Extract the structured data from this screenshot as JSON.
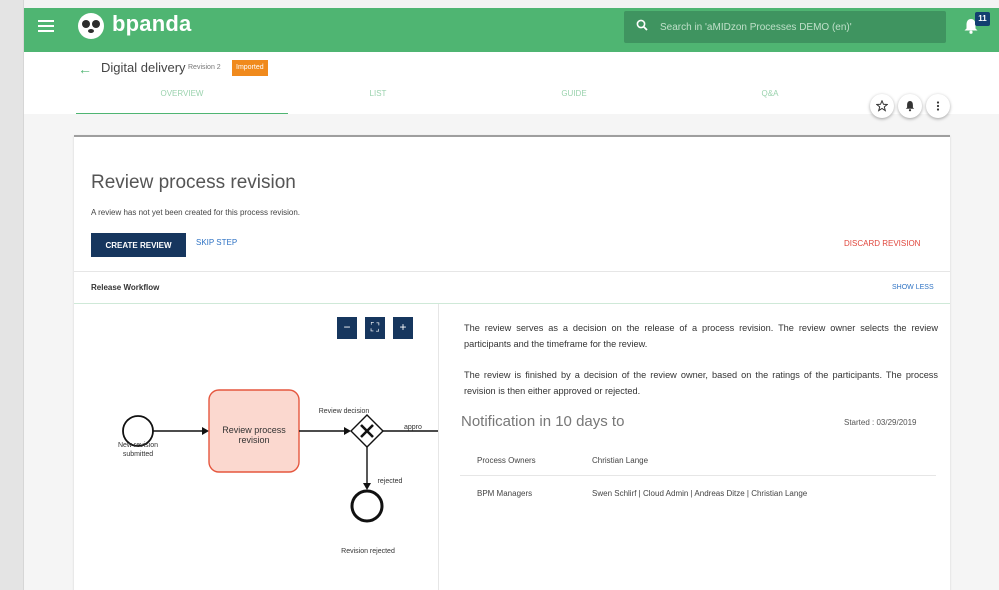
{
  "app": {
    "brand": "bpanda",
    "search_placeholder": "Search in 'aMIDzon Processes DEMO (en)'",
    "notification_count": "11"
  },
  "header": {
    "process_title": "Digital delivery",
    "revision": "Revision 2",
    "badge": "Imported",
    "tabs": [
      {
        "label": "OVERVIEW"
      },
      {
        "label": "LIST"
      },
      {
        "label": "GUIDE"
      },
      {
        "label": "Q&A"
      }
    ],
    "active_tab": "OVERVIEW"
  },
  "review": {
    "title": "Review process revision",
    "description": "A review has not yet been created for this process revision.",
    "create_label": "CREATE REVIEW",
    "skip_label": "SKIP STEP",
    "discard_label": "DISCARD REVISION"
  },
  "workflow": {
    "title": "Release Workflow",
    "toggle_label": "SHOW LESS",
    "zoom": {
      "out": "−",
      "fit": "⛶",
      "in": "+"
    },
    "diagram": {
      "start_label": "New revision submitted",
      "task_label": "Review process revision",
      "gateway_label": "Review decision",
      "approved_label": "appro",
      "rejected_edge_label": "rejected",
      "end_label": "Revision rejected"
    }
  },
  "details": {
    "paragraph_1": "The review serves as a decision on the release of a process revision. The review owner selects the review participants and the timeframe for the review.",
    "paragraph_2": "The review is finished by a decision of the review owner, based on the ratings of the participants. The process revision is then either approved or rejected.",
    "notification_title": "Notification in 10 days to",
    "started": "Started : 03/29/2019",
    "recipients": [
      {
        "role": "Process Owners",
        "names": "Christian Lange"
      },
      {
        "role": "BPM Managers",
        "names": "Swen Schlirf | Cloud Admin | Andreas Ditze | Christian Lange"
      }
    ]
  },
  "colors": {
    "brand_green": "#4fb572",
    "navy": "#16365e",
    "badge_orange": "#f08a1d",
    "danger_red": "#e0463c",
    "link_blue": "#2f73c4",
    "task_fill": "#fbd8cf",
    "task_border": "#e5573f"
  }
}
